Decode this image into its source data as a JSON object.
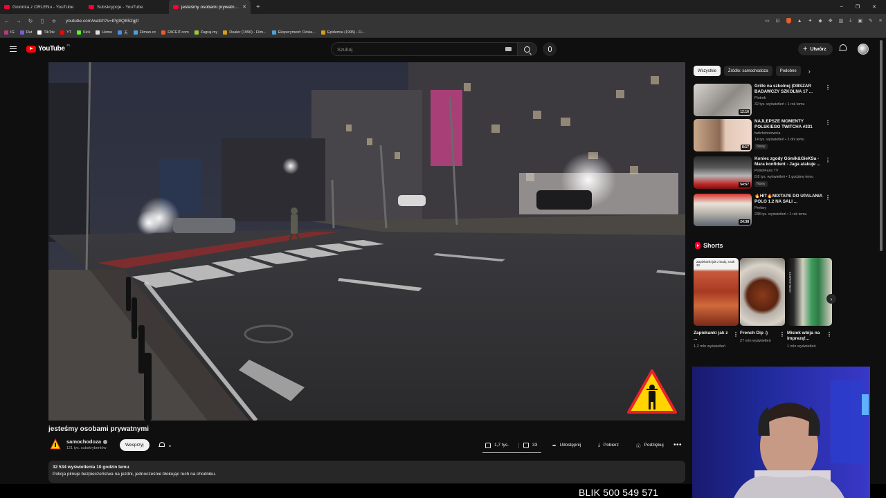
{
  "browser": {
    "tabs": [
      {
        "title": "Golonka z ORLENu - YouTube",
        "active": false
      },
      {
        "title": "Subskrypcje - YouTube",
        "active": false
      },
      {
        "title": "jesteśmy osobami prywatnymi",
        "active": true
      }
    ],
    "new_tab_icon": "plus-icon",
    "url": "youtube.com/watch?v=tPg9QB52gj0",
    "window_controls": [
      "–",
      "❐",
      "✕"
    ],
    "bookmarks": [
      "IG",
      "Rat",
      "TikTok",
      "YT",
      "Kick",
      "Home",
      "天",
      "Filman.cc",
      "FACEIT.com",
      "Zagraj.my",
      "Dealer (1996) - Film...",
      "Eksperyment: Odsia...",
      "Epidemia (1995) - Fi..."
    ],
    "bookmark_colors": [
      "#c13584",
      "#7b5cd6",
      "#ffffff",
      "#ff0000",
      "#53fc18",
      "#dddddd",
      "#4a8fe7",
      "#4aa3df",
      "#f05a28",
      "#9acd32",
      "#d4a017",
      "#4aa3df",
      "#d4a017"
    ]
  },
  "youtube": {
    "logo_text": "YouTube",
    "logo_country": "PL",
    "search_placeholder": "Szukaj",
    "create_label": "Utwórz"
  },
  "video": {
    "title": "jesteśmy osobami prywatnymi",
    "channel": "samochodoza",
    "subscribers": "121 tys. subskrybentów",
    "support_label": "Wesprzyj",
    "likes": "1,7 tys.",
    "dislikes": "33",
    "share_label": "Udostępnij",
    "download_label": "Pobierz",
    "thanks_label": "Podziękuj",
    "more_label": "•••",
    "views_time": "32 534 wyświetlenia  10 godzin temu",
    "description": "Policja pilnuje bezpieczeństwa na jezdni, jednocześnie blokując ruch na chodniku."
  },
  "filter_chips": [
    {
      "label": "Wszystkie",
      "active": true
    },
    {
      "label": "Źródło: samochodoza",
      "active": false
    },
    {
      "label": "Podobne",
      "active": false
    }
  ],
  "recommendations": [
    {
      "title": "Grille na szkolnej |OBSZAR BADAWCZY SZKOLNA 17 ...",
      "channel": "Piotrek",
      "stats": "32 tys. wyświetleń • 1 rok temu",
      "duration": "12:16",
      "badge": ""
    },
    {
      "title": "NAJLEPSZE MOMENTY POLSKIEGO TWITCHA #331",
      "channel": "twitchshotownia",
      "stats": "14 tys. wyświetleń • 2 dni temu",
      "duration": "8:17",
      "badge": "Nowy"
    },
    {
      "title": "Koniec zgody Gómik&GieKSa - Mara konfident - Jaga atakuje ...",
      "channel": "PolishFans TV",
      "stats": "8,8 tys. wyświetleń • 1 godzinę temu",
      "duration": "54:57",
      "badge": "Nowy"
    },
    {
      "title": "🔥HIT🔥MIXTAPE DO UPALANIA POLO 1.2 NA SALI ...",
      "channel": "Prefary",
      "stats": "238 tys. wyświetleń • 1 rok temu",
      "duration": "24:38",
      "badge": ""
    }
  ],
  "shorts": {
    "heading": "Shorts",
    "items": [
      {
        "title": "Zapiekanki jak z ...",
        "views": "1,2 mln wyświetleń",
        "overlay": "Zapiekanki jak z budy, a tak 30"
      },
      {
        "title": "French Dip :)",
        "views": "27 mln wyświetleń",
        "overlay": ""
      },
      {
        "title": "Misiek wbija na imprezę!...",
        "views": "1 mln wyświetleń",
        "overlay": "EKSPERYMENT"
      }
    ]
  },
  "overlay_text": "BLIK 500 549 571",
  "colors": {
    "brand_red": "#ff0000",
    "background": "#0f0f0f",
    "chip_bg": "#272727",
    "warning_sign": "#ffd400"
  }
}
